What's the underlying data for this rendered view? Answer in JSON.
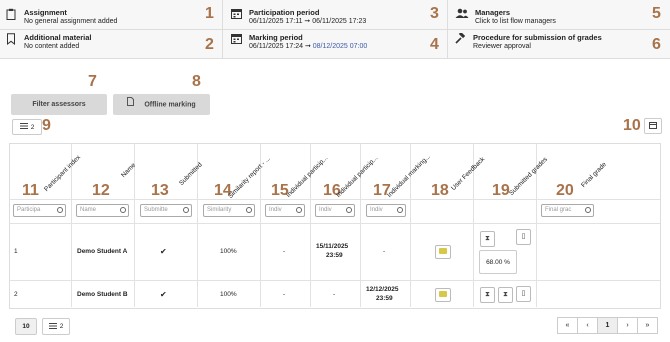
{
  "info": {
    "assignment": {
      "title": "Assignment",
      "sub": "No general assignment added"
    },
    "additional": {
      "title": "Additional material",
      "sub": "No content added"
    },
    "participation": {
      "title": "Participation period",
      "start": "06/11/2025 17:11",
      "end": "06/11/2025 17:23"
    },
    "marking": {
      "title": "Marking period",
      "start": "06/11/2025 17:24",
      "end": "08/12/2025 07:00"
    },
    "managers": {
      "title": "Managers",
      "sub": "Click to list flow managers"
    },
    "procedure": {
      "title": "Procedure for submission of grades",
      "sub": "Reviewer approval"
    }
  },
  "numbers": [
    "1",
    "2",
    "3",
    "4",
    "5",
    "6",
    "7",
    "8",
    "9",
    "10",
    "11",
    "12",
    "13",
    "14",
    "15",
    "16",
    "17",
    "18",
    "19",
    "20"
  ],
  "buttons": {
    "filter": "Filter assessors",
    "offline": "Offline marking"
  },
  "toggle_count": "2",
  "columns": [
    "Participant index",
    "Name",
    "Submitted",
    "Similarity report - ...",
    "Individual particip...",
    "Individual particip...",
    "Individual marking...",
    "User Feedback",
    "Submitted grades",
    "Final grade"
  ],
  "filters": [
    "Participa",
    "Name",
    "Submitte",
    "Similarity",
    "Indiv",
    "Indiv",
    "Indiv",
    "Final grac"
  ],
  "rows": [
    {
      "index": "1",
      "name": "Demo Student A",
      "submitted": "✔",
      "similarity": "100%",
      "ip1": "-",
      "ip2_date": "15/11/2025",
      "ip2_time": "23:59",
      "marking": "-",
      "grade": "68.00 %"
    },
    {
      "index": "2",
      "name": "Demo Student B",
      "submitted": "✔",
      "similarity": "100%",
      "ip1": "-",
      "ip2": "-",
      "marking_date": "12/12/2025",
      "marking_time": "23:59"
    }
  ],
  "footer": {
    "page_size": "10",
    "toggle_count": "2",
    "first": "«",
    "prev": "‹",
    "page": "1",
    "next": "›",
    "last": "»"
  },
  "colors": {
    "number_label": "#a8734a",
    "link_blue": "#3b5aa8",
    "feedback_icon": "#d7c84a"
  }
}
